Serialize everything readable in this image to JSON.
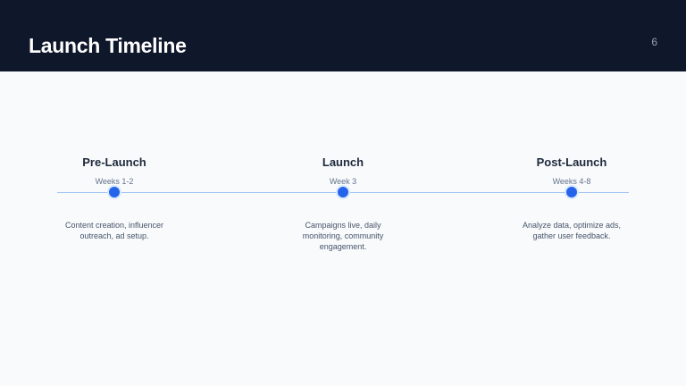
{
  "header": {
    "title": "Launch Timeline",
    "page_number": "6"
  },
  "timeline": {
    "steps": [
      {
        "title": "Pre-Launch",
        "period": "Weeks 1-2",
        "description": "Content creation, influencer outreach, ad setup."
      },
      {
        "title": "Launch",
        "period": "Week 3",
        "description": "Campaigns live, daily monitoring, community engagement."
      },
      {
        "title": "Post-Launch",
        "period": "Weeks 4-8",
        "description": "Analyze data, optimize ads, gather user feedback."
      }
    ]
  },
  "colors": {
    "header_bg": "#0f172a",
    "accent": "#2563eb",
    "line": "#9fc4f2"
  }
}
